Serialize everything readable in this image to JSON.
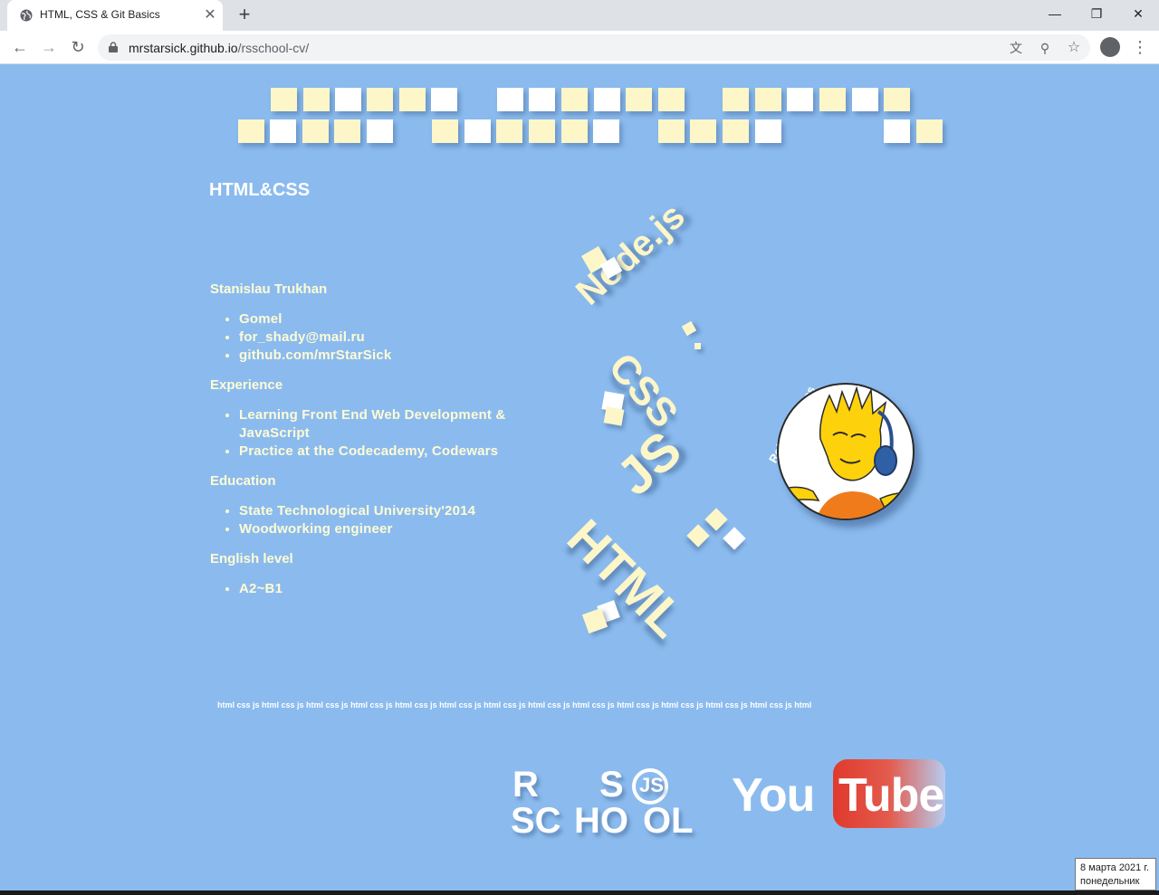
{
  "browser": {
    "tab_title": "HTML, CSS & Git Basics",
    "tab_close": "✕",
    "new_tab": "+",
    "url_host": "mrstarsick.github.io",
    "url_path": "/rsschool-cv/",
    "window_minimize": "—",
    "window_restore": "❐",
    "window_close": "✕",
    "back": "←",
    "forward": "→",
    "reload": "↻",
    "translate_icon": "文",
    "zoom_icon": "⚲",
    "star_icon": "☆",
    "menu_icon": "⋮"
  },
  "page": {
    "section_title": "HTML&CSS",
    "cv": {
      "name": "Stanislau Trukhan",
      "contacts": [
        "Gomel",
        "for_shady@mail.ru",
        "github.com/mrStarSick"
      ],
      "experience_title": "Experience",
      "experience": [
        "Learning Front End Web Development & JavaScript",
        "Practice at the Codecademy, Codewars"
      ],
      "education_title": "Education",
      "education": [
        "State Technological University'2014",
        "Woodworking engineer"
      ],
      "english_title": "English level",
      "english": [
        "A2~B1"
      ]
    },
    "words": {
      "node": "Node.js",
      "css": "CSS",
      "js": "JS",
      "html": "HTML"
    },
    "badge_text": "Rolling Scopes",
    "ticker": "html css js html css js html css js html css js html css js html css js html css js html css js html css js html css js html css js html css js html css js html",
    "rs_logo": {
      "r": "R",
      "s": "S",
      "js": "JS",
      "sc": "SC",
      "ho": "HO",
      "ol": "OL"
    },
    "youtube": {
      "you": "You",
      "tube": "Tube"
    }
  },
  "taskbar": {
    "date": "8 марта 2021 г.",
    "weekday": "понедельник"
  },
  "colors": {
    "page_bg": "#8bbbee",
    "text_cream": "#fefbd6",
    "tile_yellow": "#fdf6c8",
    "youtube_red": "#e03a2c"
  }
}
